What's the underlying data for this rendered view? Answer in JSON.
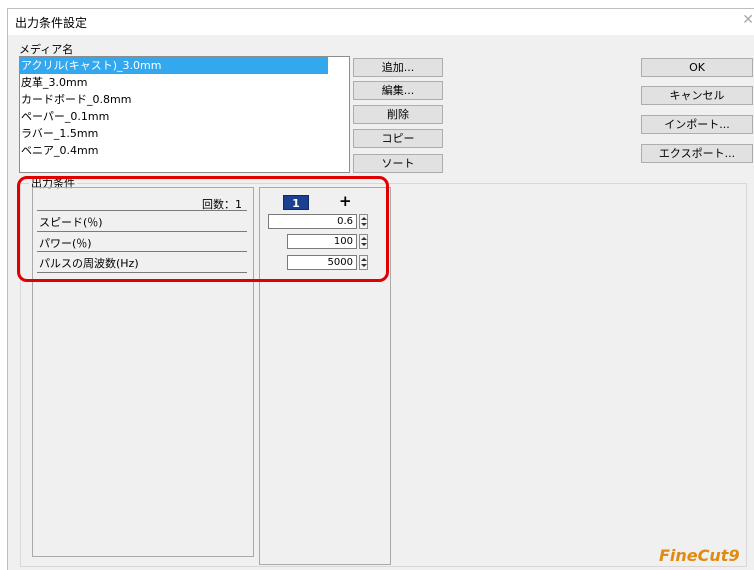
{
  "window": {
    "title": "出力条件設定",
    "close_icon": "close-icon"
  },
  "media": {
    "label": "メディア名",
    "items": [
      {
        "label": "アクリル(キャスト)_3.0mm",
        "selected": true
      },
      {
        "label": "皮革_3.0mm",
        "selected": false
      },
      {
        "label": "カードボード_0.8mm",
        "selected": false
      },
      {
        "label": "ペーパー_0.1mm",
        "selected": false
      },
      {
        "label": "ラバー_1.5mm",
        "selected": false
      },
      {
        "label": "ベニア_0.4mm",
        "selected": false
      }
    ]
  },
  "media_buttons": {
    "add": "追加...",
    "edit": "編集...",
    "delete": "削除",
    "copy": "コピー",
    "sort": "ソート"
  },
  "dialog_buttons": {
    "ok": "OK",
    "cancel": "キャンセル",
    "import": "インポート...",
    "export": "エクスポート..."
  },
  "output": {
    "group_label": "出力条件",
    "count_label": "回数：1",
    "tab_label": "1",
    "add_tab": "+",
    "rows": [
      {
        "label": "スピード(％)",
        "value": "0.6"
      },
      {
        "label": "パワー(％)",
        "value": "100"
      },
      {
        "label": "パルスの周波数(Hz)",
        "value": "5000"
      }
    ]
  },
  "logo_text": "FineCut9",
  "colors": {
    "selection": "#33a8ee",
    "tab_active": "#1c3f8f",
    "highlight_box": "#e00000",
    "logo": "#e08a12"
  }
}
